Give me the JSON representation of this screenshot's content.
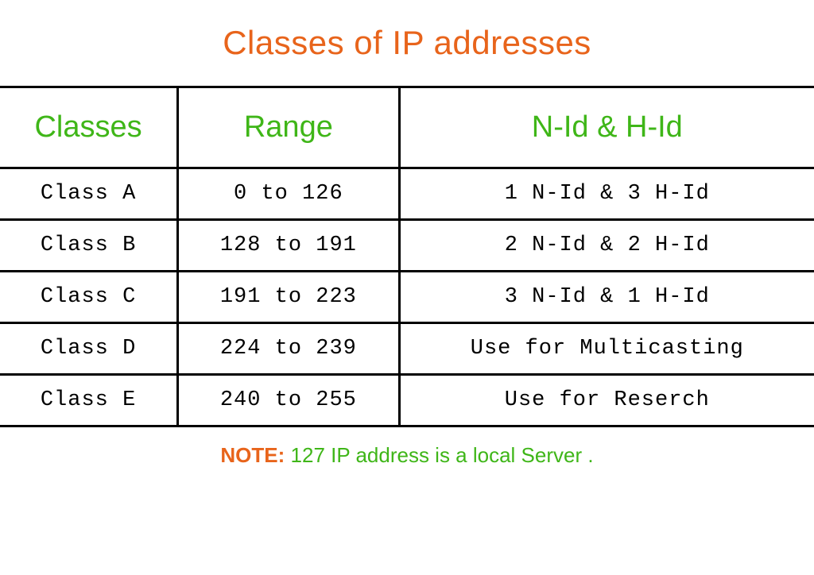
{
  "title": "Classes of IP addresses",
  "headers": {
    "col1": "Classes",
    "col2": "Range",
    "col3": "N-Id & H-Id"
  },
  "rows": [
    {
      "classes": "Class A",
      "range": "0 to 126",
      "nid": "1 N-Id & 3 H-Id"
    },
    {
      "classes": "Class B",
      "range": "128 to 191",
      "nid": "2 N-Id & 2 H-Id"
    },
    {
      "classes": "Class C",
      "range": "191 to 223",
      "nid": "3 N-Id & 1 H-Id"
    },
    {
      "classes": "Class D",
      "range": "224 to 239",
      "nid": "Use for Multicasting"
    },
    {
      "classes": "Class E",
      "range": "240 to 255",
      "nid": "Use for Reserch"
    }
  ],
  "note": {
    "label": "NOTE:",
    "text": " 127 IP address is a local Server ."
  }
}
